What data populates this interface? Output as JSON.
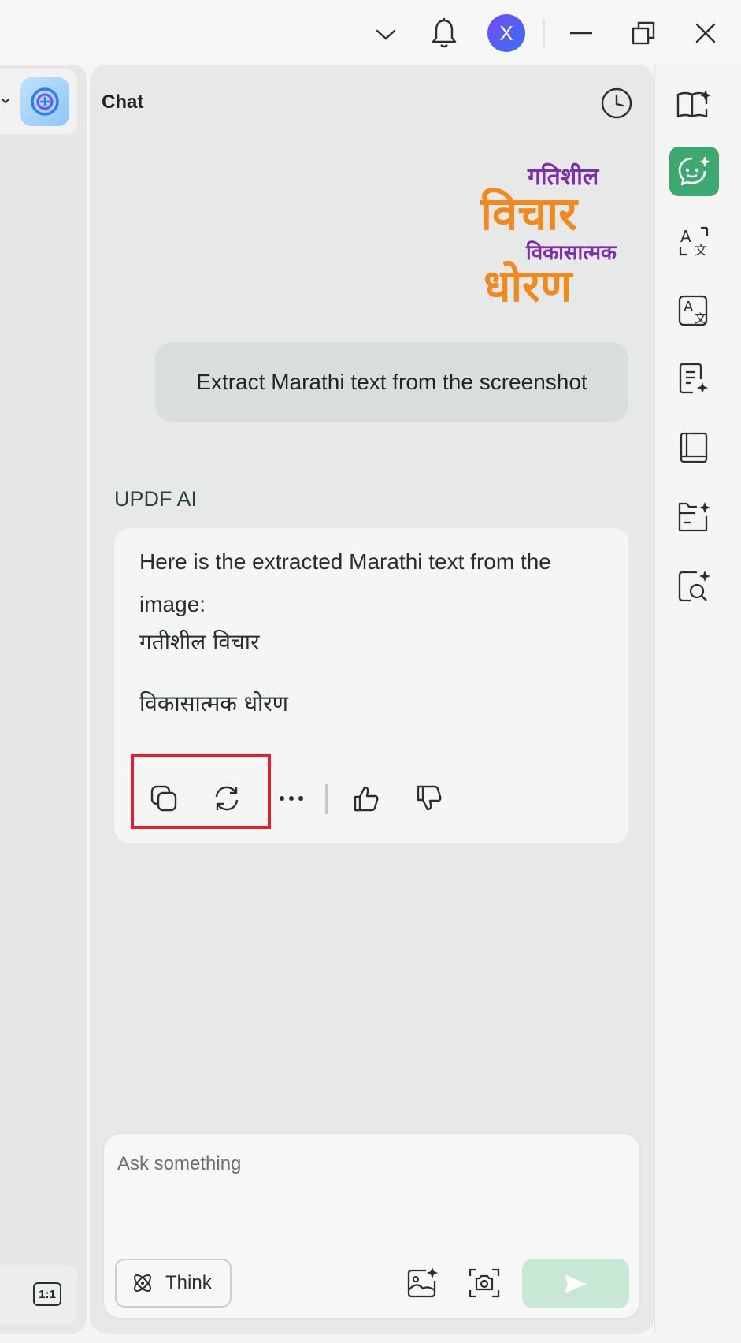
{
  "window": {
    "avatar_letter": "X",
    "icons": [
      "chevron-down-icon",
      "bell-icon",
      "minimize-icon",
      "restore-icon",
      "close-icon"
    ]
  },
  "left_panel": {
    "ratio_label": "1:1"
  },
  "chat": {
    "title": "Chat",
    "user_image": {
      "lines": [
        "गतिशील",
        "विचार",
        "विकासात्मक",
        "धोरण"
      ],
      "colors": {
        "purple": "#7b2fa8",
        "orange": "#f08a1c"
      }
    },
    "user_message": "Extract Marathi text from the screenshot",
    "ai_label": "UPDF AI",
    "ai_response": {
      "intro_line1": "Here is the extracted Marathi text from the",
      "intro_line2": "image:",
      "line1": "गतीशील विचार",
      "line2": "विकासात्मक धोरण"
    },
    "actions": [
      "copy-icon",
      "regenerate-icon",
      "more-icon",
      "thumbs-up-icon",
      "thumbs-down-icon"
    ]
  },
  "input": {
    "placeholder": "Ask something",
    "think_label": "Think"
  },
  "colors": {
    "accent_green": "#3da870",
    "highlight_red": "#e0202c",
    "send_disabled": "#c9e7d5"
  },
  "right_toolbar": [
    "book-ai-icon",
    "chat-ai-icon",
    "translate-icon",
    "translate-box-icon",
    "summarize-icon",
    "notebook-icon",
    "folder-ai-icon",
    "search-ai-icon"
  ]
}
